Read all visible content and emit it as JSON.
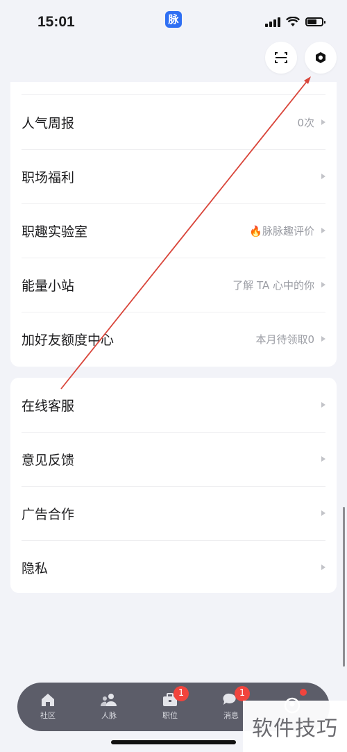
{
  "status_bar": {
    "time": "15:01",
    "app_badge": "脉"
  },
  "menu_group_1": [
    {
      "label": "人气周报",
      "value": "0次"
    },
    {
      "label": "职场福利",
      "value": ""
    },
    {
      "label": "职趣实验室",
      "value": "🔥脉脉趣评价"
    },
    {
      "label": "能量小站",
      "value": "了解 TA 心中的你"
    },
    {
      "label": "加好友额度中心",
      "value": "本月待领取0"
    }
  ],
  "menu_group_2": [
    {
      "label": "在线客服"
    },
    {
      "label": "意见反馈"
    },
    {
      "label": "广告合作"
    },
    {
      "label": "隐私"
    }
  ],
  "tabbar": {
    "tabs": [
      {
        "label": "社区",
        "icon": "home-icon"
      },
      {
        "label": "人脉",
        "icon": "people-icon"
      },
      {
        "label": "职位",
        "icon": "briefcase-icon",
        "badge": "1"
      },
      {
        "label": "消息",
        "icon": "chat-icon",
        "badge": "1"
      },
      {
        "label": "",
        "icon": "profile-icon"
      }
    ]
  },
  "watermark": "软件技巧",
  "colors": {
    "accent_badge": "#f1443d",
    "app_badge_bg": "#2f6ff3",
    "tabbar_bg": "#5c5d69",
    "annotation_arrow": "#d9463b"
  }
}
